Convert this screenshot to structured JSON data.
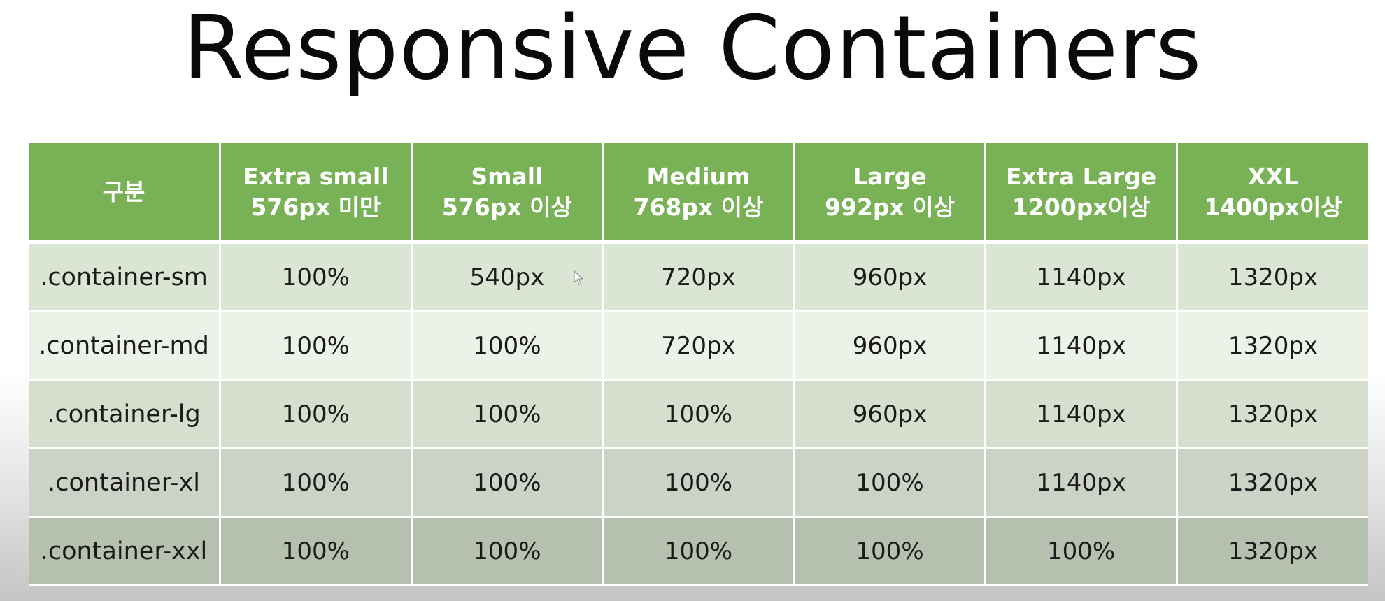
{
  "title": "Responsive Containers",
  "table": {
    "headers": [
      {
        "line1": "구분",
        "line2": ""
      },
      {
        "line1": "Extra small",
        "line2": "576px 미만"
      },
      {
        "line1": "Small",
        "line2": "576px 이상"
      },
      {
        "line1": "Medium",
        "line2": "768px 이상"
      },
      {
        "line1": "Large",
        "line2": "992px 이상"
      },
      {
        "line1": "Extra Large",
        "line2": "1200px이상"
      },
      {
        "line1": "XXL",
        "line2": "1400px이상"
      }
    ],
    "rows": [
      [
        ".container-sm",
        "100%",
        "540px",
        "720px",
        "960px",
        "1140px",
        "1320px"
      ],
      [
        ".container-md",
        "100%",
        "100%",
        "720px",
        "960px",
        "1140px",
        "1320px"
      ],
      [
        ".container-lg",
        "100%",
        "100%",
        "100%",
        "960px",
        "1140px",
        "1320px"
      ],
      [
        ".container-xl",
        "100%",
        "100%",
        "100%",
        "100%",
        "1140px",
        "1320px"
      ],
      [
        ".container-xxl",
        "100%",
        "100%",
        "100%",
        "100%",
        "100%",
        "1320px"
      ]
    ]
  },
  "colors": {
    "header_bg": "#79b256",
    "header_text": "#ffffff"
  },
  "icons": {
    "cursor": "mouse-pointer-icon"
  }
}
